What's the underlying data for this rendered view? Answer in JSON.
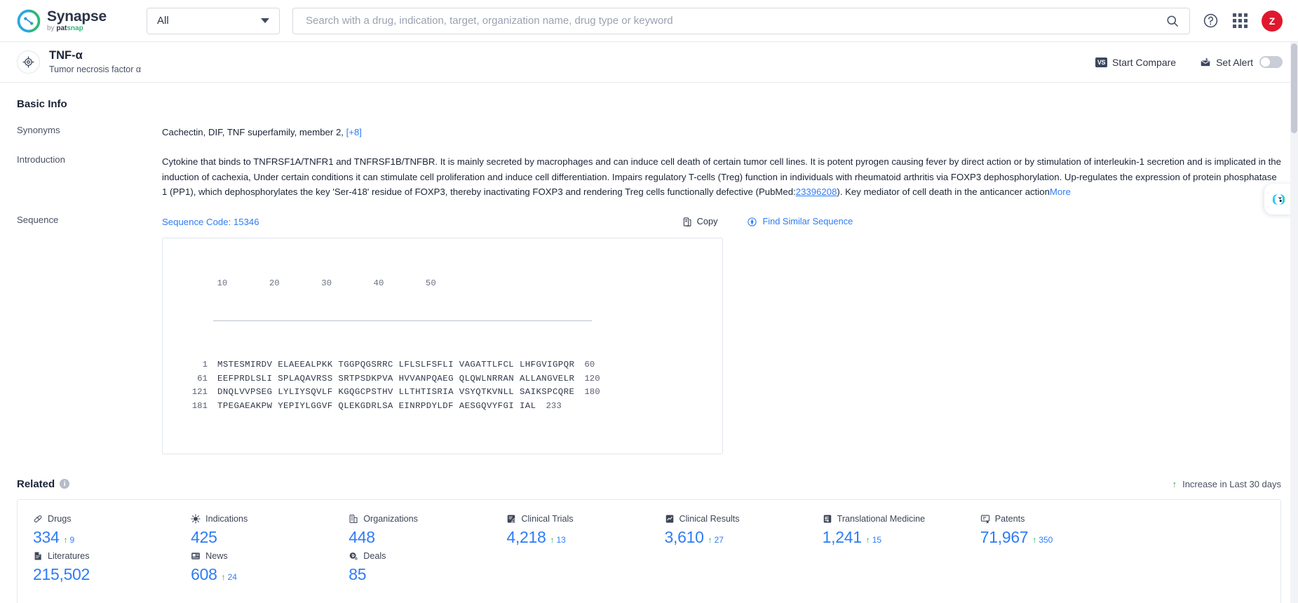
{
  "brand": {
    "name": "Synapse",
    "by": "by ",
    "pat": "pat",
    "snap": "snap"
  },
  "topnav": {
    "scope_value": "All",
    "search_placeholder": "Search with a drug, indication, target, organization name, drug type or keyword",
    "search_value": "",
    "avatar_initial": "Z"
  },
  "target_header": {
    "name": "TNF-α",
    "alias": "Tumor necrosis factor α",
    "compare_label": "Start Compare",
    "compare_badge": "VS",
    "alert_label": "Set Alert"
  },
  "basic_info": {
    "title": "Basic Info",
    "synonyms_label": "Synonyms",
    "synonyms_value": "Cachectin,  DIF,  TNF superfamily, member 2,",
    "synonyms_more": "[+8]",
    "introduction_label": "Introduction",
    "introduction_part1": "Cytokine that binds to TNFRSF1A/TNFR1 and TNFRSF1B/TNFBR. It is mainly secreted by macrophages and can induce cell death of certain tumor cell lines. It is potent pyrogen causing fever by direct action or by stimulation of interleukin-1 secretion and is implicated in the induction of cachexia, Under certain conditions it can stimulate cell proliferation and induce cell differentiation. Impairs regulatory T-cells (Treg) function in individuals with rheumatoid arthritis via FOXP3 dephosphorylation. Up-regulates the expression of protein phosphatase 1 (PP1), which dephosphorylates the key 'Ser-418' residue of FOXP3, thereby inactivating FOXP3 and rendering Treg cells functionally defective (PubMed:",
    "introduction_pubmed": "23396208",
    "introduction_part2": "). Key mediator of cell death in the anticancer action",
    "introduction_more": "More"
  },
  "sequence": {
    "label": "Sequence",
    "code_label": "Sequence Code: 15346",
    "copy_label": "Copy",
    "find_label": "Find Similar Sequence",
    "ruler": "        10        20        30        40        50",
    "rows": [
      {
        "start": "1",
        "body": "MSTESMIRDV ELAEEALPKK TGGPQGSRRC LFLSLFSFLI VAGATTLFCL LHFGVIGPQR",
        "end": "60"
      },
      {
        "start": "61",
        "body": "EEFPRDLSLI SPLAQAVRSS SRTPSDKPVA HVVANPQAEG QLQWLNRRAN ALLANGVELR",
        "end": "120"
      },
      {
        "start": "121",
        "body": "DNQLVVPSEG LYLIYSQVLF KGQGCPSTHV LLTHTISRIA VSYQTKVNLL SAIKSPCQRE",
        "end": "180"
      },
      {
        "start": "181",
        "body": "TPEGAEAKPW YEPIYLGGVF QLEKGDRLSA EINRPDYLDF AESGQVYFGI IAL",
        "end": "233"
      }
    ]
  },
  "related": {
    "title": "Related",
    "info_glyph": "i",
    "increase_note": "Increase in Last 30 days",
    "increase_arrow": "↑",
    "stats": [
      {
        "icon": "pill-icon",
        "label": "Drugs",
        "value": "334",
        "delta": "9"
      },
      {
        "icon": "virus-icon",
        "label": "Indications",
        "value": "425",
        "delta": ""
      },
      {
        "icon": "building-icon",
        "label": "Organizations",
        "value": "448",
        "delta": ""
      },
      {
        "icon": "clinical-trial-icon",
        "label": "Clinical Trials",
        "value": "4,218",
        "delta": "13"
      },
      {
        "icon": "clinical-result-icon",
        "label": "Clinical Results",
        "value": "3,610",
        "delta": "27"
      },
      {
        "icon": "translational-medicine-icon",
        "label": "Translational Medicine",
        "value": "1,241",
        "delta": "15"
      },
      {
        "icon": "patent-icon",
        "label": "Patents",
        "value": "71,967",
        "delta": "350"
      },
      {
        "icon": "spacer",
        "label": "",
        "value": "",
        "delta": ""
      },
      {
        "icon": "literature-icon",
        "label": "Literatures",
        "value": "215,502",
        "delta": ""
      },
      {
        "icon": "news-icon",
        "label": "News",
        "value": "608",
        "delta": "24"
      },
      {
        "icon": "deal-icon",
        "label": "Deals",
        "value": "85",
        "delta": ""
      }
    ]
  },
  "colors": {
    "accent_blue": "#2e7cf6",
    "increase_green": "#2aa84a",
    "avatar_red": "#e0182d",
    "text_dark": "#1b2436"
  }
}
